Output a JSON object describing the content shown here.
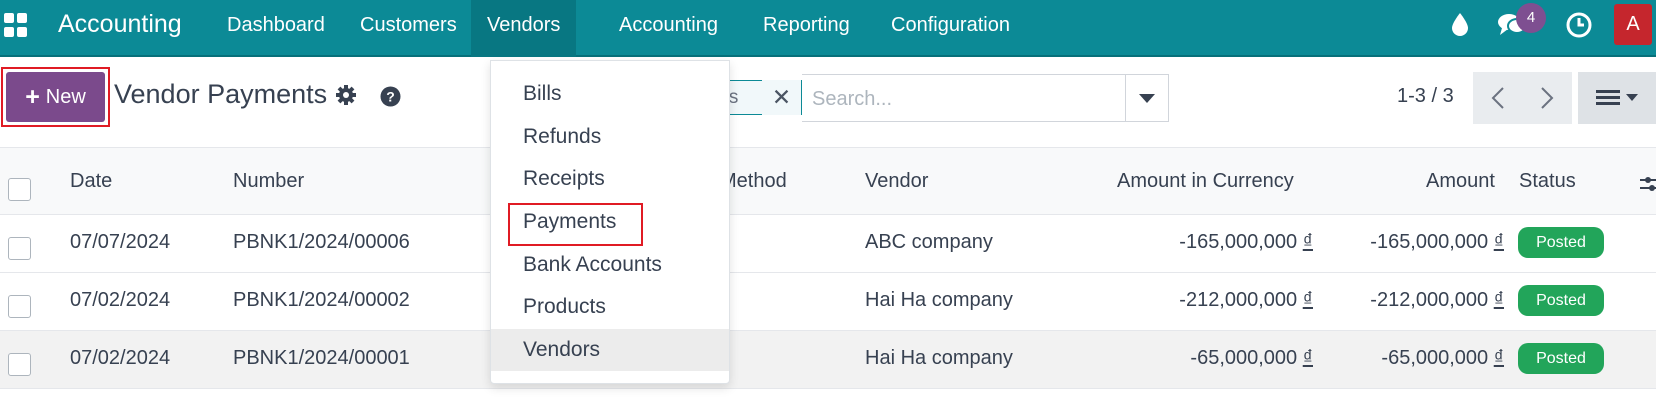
{
  "navbar": {
    "app_name": "Accounting",
    "menu": [
      "Dashboard",
      "Customers",
      "Vendors",
      "Accounting",
      "Reporting",
      "Configuration"
    ],
    "active_menu": "Vendors",
    "messages_count": "4",
    "avatar_initial": "A",
    "icons": [
      "apps-grid-icon",
      "droplet-icon",
      "chat-icon",
      "clock-icon"
    ]
  },
  "control_panel": {
    "new_label": "New",
    "title": "Vendor Payments",
    "facet_label": "nts",
    "search_placeholder": "Search...",
    "pager": "1-3 / 3"
  },
  "table": {
    "columns": [
      "Date",
      "Number",
      "Method",
      "Vendor",
      "Amount in Currency",
      "Amount",
      "Status"
    ],
    "rows": [
      {
        "date": "07/07/2024",
        "number": "PBNK1/2024/00006",
        "vendor": "ABC company",
        "amount_currency": "-165,000,000",
        "amount": "-165,000,000",
        "currency_symbol": "₫",
        "status": "Posted"
      },
      {
        "date": "07/02/2024",
        "number": "PBNK1/2024/00002",
        "vendor": "Hai Ha company",
        "amount_currency": "-212,000,000",
        "amount": "-212,000,000",
        "currency_symbol": "₫",
        "status": "Posted"
      },
      {
        "date": "07/02/2024",
        "number": "PBNK1/2024/00001",
        "vendor": "Hai Ha company",
        "amount_currency": "-65,000,000",
        "amount": "-65,000,000",
        "currency_symbol": "₫",
        "status": "Posted"
      }
    ]
  },
  "vendors_menu": {
    "items": [
      "Bills",
      "Refunds",
      "Receipts",
      "Payments",
      "Bank Accounts",
      "Products",
      "Vendors"
    ],
    "highlighted": "Payments",
    "hovered": "Vendors"
  },
  "colors": {
    "navbar": "#0c8a96",
    "primary_button": "#7b4a8c",
    "status_posted": "#22a55a",
    "highlight_box": "#e01b24"
  }
}
